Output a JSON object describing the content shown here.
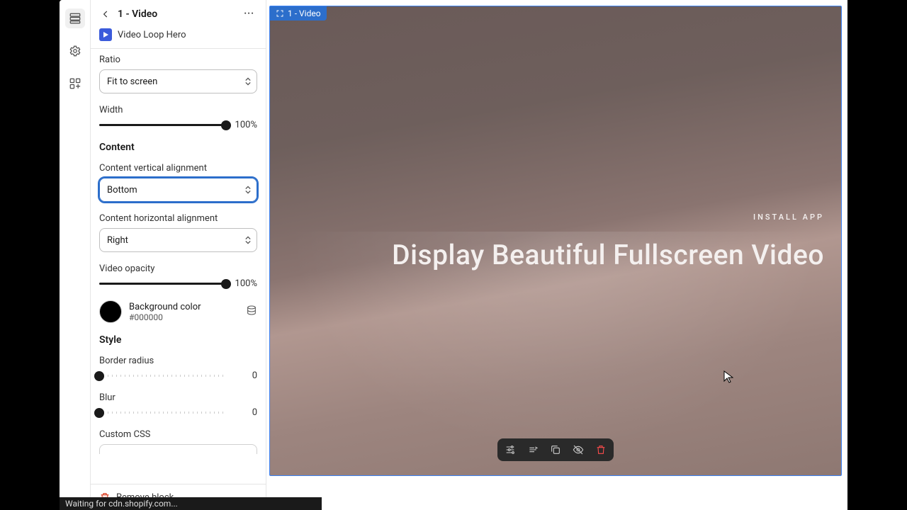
{
  "header": {
    "title": "1 - Video",
    "subtitle": "Video Loop Hero"
  },
  "fields": {
    "ratio": {
      "label": "Ratio",
      "value": "Fit to screen"
    },
    "width": {
      "label": "Width",
      "value": "100%",
      "pct": 100
    },
    "content_section": "Content",
    "valign": {
      "label": "Content vertical alignment",
      "value": "Bottom"
    },
    "halign": {
      "label": "Content horizontal alignment",
      "value": "Right"
    },
    "opacity": {
      "label": "Video opacity",
      "value": "100%",
      "pct": 100
    },
    "bgcolor": {
      "label": "Background color",
      "value": "#000000",
      "hex": "#000000"
    },
    "style_section": "Style",
    "radius": {
      "label": "Border radius",
      "value": "0",
      "pct": 0
    },
    "blur": {
      "label": "Blur",
      "value": "0",
      "pct": 0
    },
    "css": {
      "label": "Custom CSS"
    }
  },
  "footer": {
    "remove": "Remove block"
  },
  "preview": {
    "badge": "1 - Video",
    "small": "INSTALL APP",
    "big": "Display Beautiful Fullscreen Video"
  },
  "status": "Waiting for cdn.shopify.com...",
  "colors": {
    "accent": "#2c6ecb"
  }
}
